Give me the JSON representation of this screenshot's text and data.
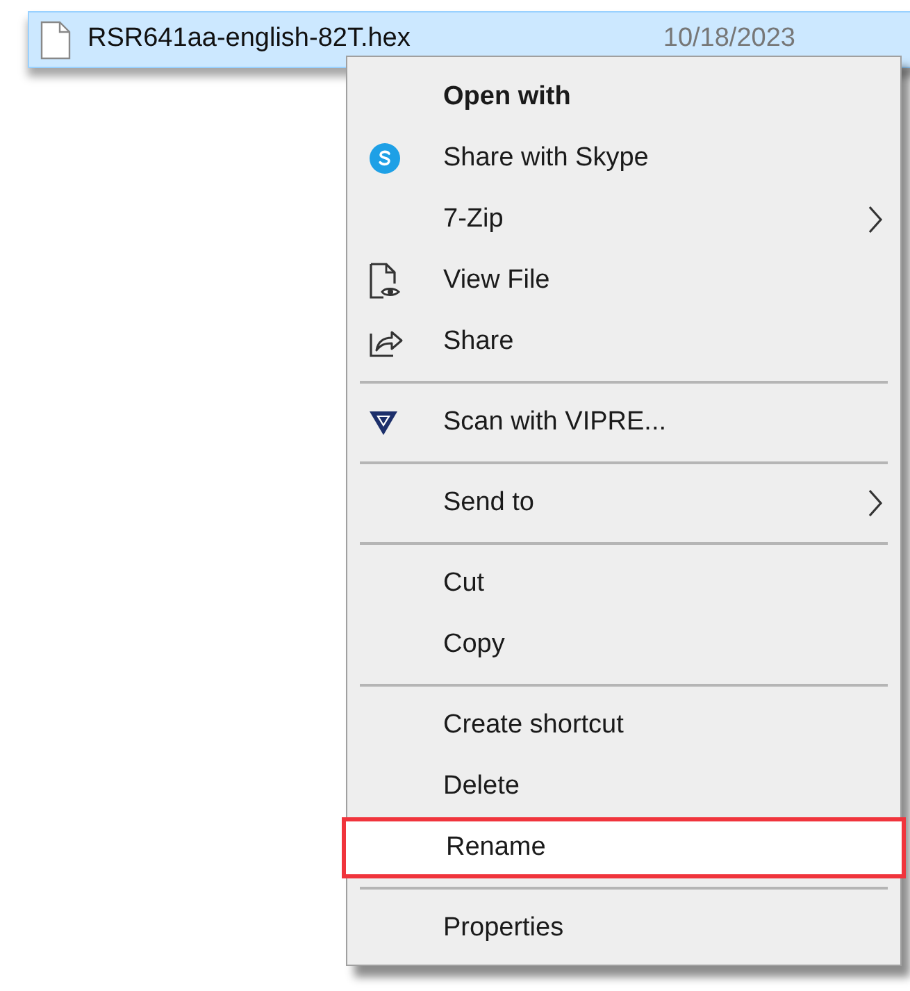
{
  "file_row": {
    "name": "RSR641aa-english-82T.hex",
    "date": "10/18/2023",
    "selected": true
  },
  "context_menu": {
    "items": [
      {
        "kind": "item",
        "label": "Open with",
        "bold": true,
        "submenu": false,
        "highlighted": false
      },
      {
        "kind": "item",
        "label": "Share with Skype",
        "bold": false,
        "submenu": false,
        "highlighted": false
      },
      {
        "kind": "item",
        "label": "7-Zip",
        "bold": false,
        "submenu": true,
        "highlighted": false
      },
      {
        "kind": "item",
        "label": "View File",
        "bold": false,
        "submenu": false,
        "highlighted": false
      },
      {
        "kind": "item",
        "label": "Share",
        "bold": false,
        "submenu": false,
        "highlighted": false
      },
      {
        "kind": "separator"
      },
      {
        "kind": "item",
        "label": "Scan with VIPRE...",
        "bold": false,
        "submenu": false,
        "highlighted": false
      },
      {
        "kind": "separator"
      },
      {
        "kind": "item",
        "label": "Send to",
        "bold": false,
        "submenu": true,
        "highlighted": false
      },
      {
        "kind": "separator"
      },
      {
        "kind": "item",
        "label": "Cut",
        "bold": false,
        "submenu": false,
        "highlighted": false
      },
      {
        "kind": "item",
        "label": "Copy",
        "bold": false,
        "submenu": false,
        "highlighted": false
      },
      {
        "kind": "separator"
      },
      {
        "kind": "item",
        "label": "Create shortcut",
        "bold": false,
        "submenu": false,
        "highlighted": false
      },
      {
        "kind": "item",
        "label": "Delete",
        "bold": false,
        "submenu": false,
        "highlighted": false
      },
      {
        "kind": "item",
        "label": "Rename",
        "bold": false,
        "submenu": false,
        "highlighted": true
      },
      {
        "kind": "separator"
      },
      {
        "kind": "item",
        "label": "Properties",
        "bold": false,
        "submenu": false,
        "highlighted": false
      }
    ]
  }
}
